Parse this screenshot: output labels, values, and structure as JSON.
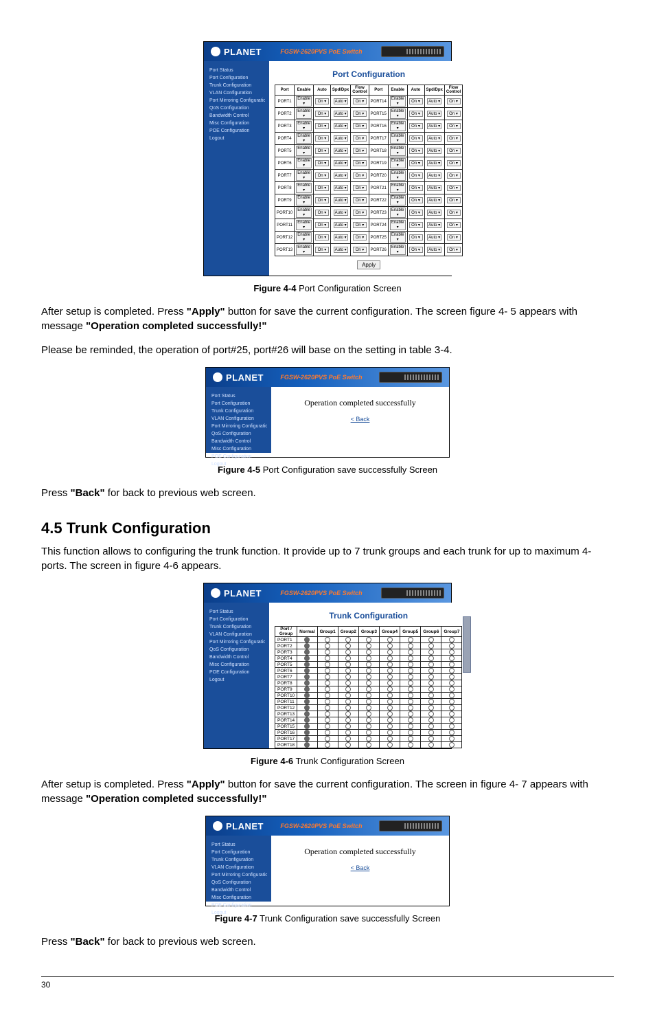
{
  "brand": "PLANET",
  "product": "FGSW-2620PVS PoE Switch",
  "nav": [
    "Port Status",
    "Port Configuration",
    "Trunk Configuration",
    "VLAN Configuration",
    "Port Mirroring Configuration",
    "QoS Configuration",
    "Bandwidth Control",
    "Misc Configuration",
    "POE Configuration",
    "Logout"
  ],
  "fig44": {
    "title": "Port Configuration",
    "cols": [
      "Port",
      "Enable",
      "Auto",
      "Spd/Dpx",
      "Flow Control",
      "Port",
      "Enable",
      "Auto",
      "Spd/Dpx",
      "Flow Control"
    ],
    "leftPorts": [
      "PORT1",
      "PORT2",
      "PORT3",
      "PORT4",
      "PORT5",
      "PORT6",
      "PORT7",
      "PORT8",
      "PORT9",
      "PORT10",
      "PORT11",
      "PORT12",
      "PORT13"
    ],
    "rightPorts": [
      "PORT14",
      "PORT15",
      "PORT16",
      "PORT17",
      "PORT18",
      "PORT19",
      "PORT20",
      "PORT21",
      "PORT22",
      "PORT23",
      "PORT24",
      "PORT25",
      "PORT26"
    ],
    "enable": "Enable ▾",
    "auto": "On ▾",
    "spd": "Auto ▾",
    "flow": "On ▾",
    "apply": "Apply",
    "caption_b": "Figure 4-4",
    "caption_t": " Port Configuration Screen"
  },
  "p1_a": "After setup is completed. Press ",
  "p1_b": "\"Apply\"",
  "p1_c": " button for save the current configuration. The screen figure 4- 5 appears with message ",
  "p1_d": "\"Operation completed successfully!\"",
  "p2": "Please be reminded, the operation of port#25, port#26 will base on the setting in table 3-4.",
  "fig45": {
    "msg": "Operation completed successfully",
    "back": "< Back",
    "caption_b": "Figure 4-5",
    "caption_t": " Port Configuration save successfully Screen"
  },
  "p3_a": "Press ",
  "p3_b": "\"Back\"",
  "p3_c": " for back to previous web screen.",
  "sec": "4.5 Trunk Configuration",
  "p4": "This function allows to configuring the trunk function. It provide up to 7 trunk groups and each trunk for up to maximum 4-ports. The screen in figure 4-6 appears.",
  "fig46": {
    "title": "Trunk Configuration",
    "cols": [
      "Port / Group",
      "Normal",
      "Group1",
      "Group2",
      "Group3",
      "Group4",
      "Group5",
      "Group6",
      "Group7"
    ],
    "rows": [
      "PORT1",
      "PORT2",
      "PORT3",
      "PORT4",
      "PORT5",
      "PORT6",
      "PORT7",
      "PORT8",
      "PORT9",
      "PORT10",
      "PORT11",
      "PORT12",
      "PORT13",
      "PORT14",
      "PORT15",
      "PORT16",
      "PORT17",
      "PORT18"
    ],
    "caption_b": "Figure 4-6",
    "caption_t": " Trunk Configuration Screen"
  },
  "p5_a": "After setup is completed. Press ",
  "p5_b": "\"Apply\"",
  "p5_c": " button for save the current configuration. The screen in figure 4- 7 appears with message ",
  "p5_d": "\"Operation completed successfully!\"",
  "fig47": {
    "msg": "Operation completed successfully",
    "back": "< Back",
    "caption_b": "Figure 4-7",
    "caption_t": " Trunk Configuration save successfully Screen"
  },
  "p6_a": "Press ",
  "p6_b": "\"Back\"",
  "p6_c": " for back to previous web screen.",
  "pageNum": "30"
}
